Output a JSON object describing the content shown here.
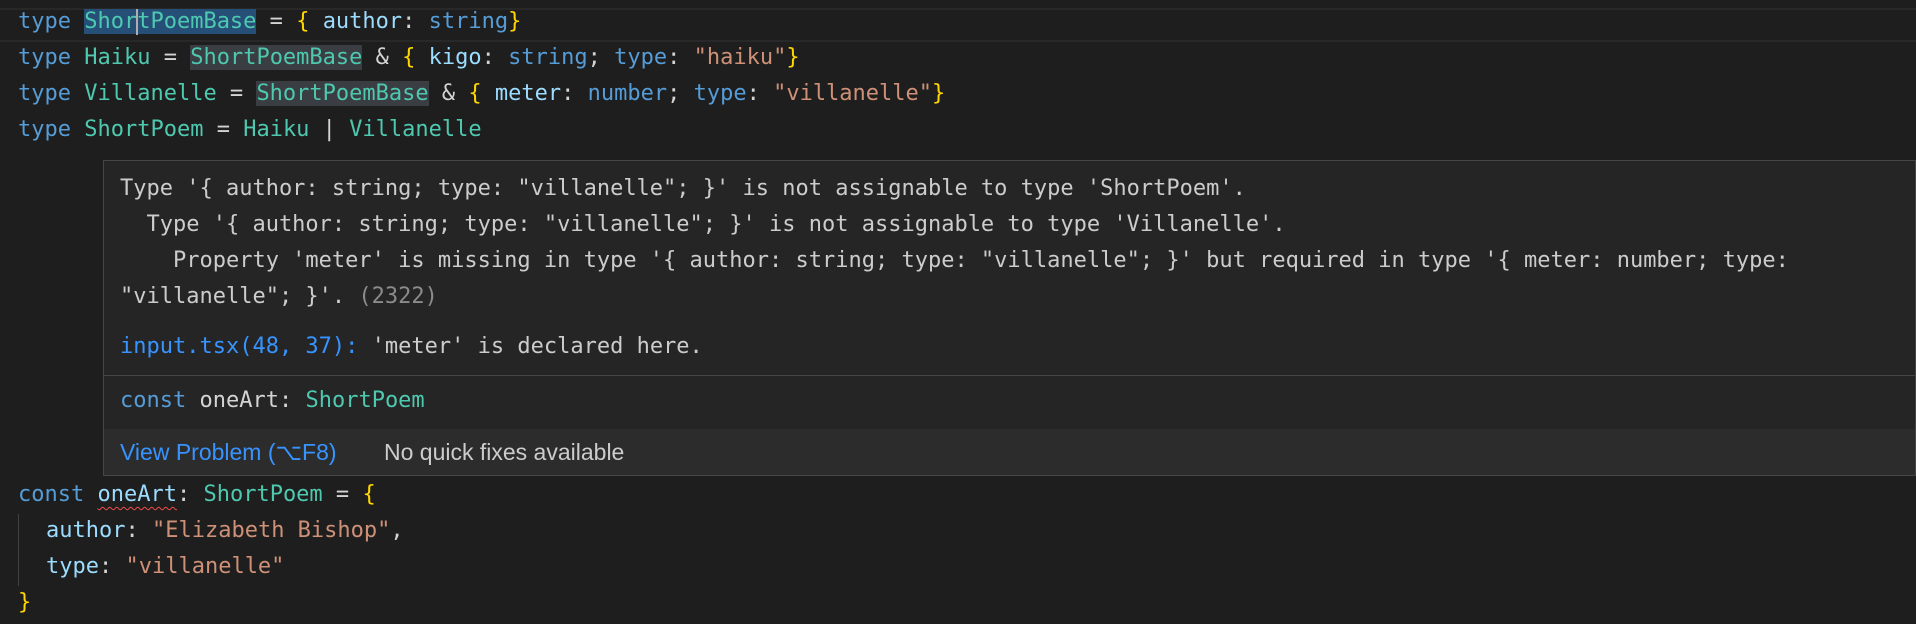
{
  "code": {
    "line1": {
      "kw": "type",
      "name_pre": "Shor",
      "name_post": "tPoemBase",
      "eq": " = ",
      "ob": "{",
      "prop": "author",
      "colon": ": ",
      "ptype": "string",
      "cb": "}"
    },
    "line2": {
      "kw": "type",
      "name": "Haiku",
      "eq": " = ",
      "base": "ShortPoemBase",
      "amp": " & ",
      "ob": "{",
      "prop1": "kigo",
      "colon1": ": ",
      "ptype1": "string",
      "semi": "; ",
      "prop2": "type",
      "colon2": ": ",
      "str": "\"haiku\"",
      "cb": "}"
    },
    "line3": {
      "kw": "type",
      "name": "Villanelle",
      "eq": " = ",
      "base": "ShortPoemBase",
      "amp": " & ",
      "ob": "{",
      "prop1": "meter",
      "colon1": ": ",
      "ptype1": "number",
      "semi": "; ",
      "prop2": "type",
      "colon2": ": ",
      "str": "\"villanelle\"",
      "cb": "}"
    },
    "line4": {
      "kw": "type",
      "name": "ShortPoem",
      "eq": " = ",
      "t1": "Haiku",
      "pipe": " | ",
      "t2": "Villanelle"
    },
    "line5": {
      "kw": "const",
      "var": "oneArt",
      "colon": ": ",
      "type": "ShortPoem",
      "eq": " = ",
      "ob": "{"
    },
    "line6": {
      "prop": "author",
      "colon": ": ",
      "str": "\"Elizabeth Bishop\"",
      "comma": ","
    },
    "line7": {
      "prop": "type",
      "colon": ": ",
      "str": "\"villanelle\""
    },
    "line8": {
      "cb": "}"
    }
  },
  "hover": {
    "messages": [
      "Type '{ author: string; type: \"villanelle\"; }' is not assignable to type 'ShortPoem'.",
      "  Type '{ author: string; type: \"villanelle\"; }' is not assignable to type 'Villanelle'.",
      "    Property 'meter' is missing in type '{ author: string; type: \"villanelle\"; }' but required in type '{ meter: number; type:",
      "\"villanelle\"; }'."
    ],
    "error_code": "(2322)",
    "related_location": "input.tsx(48, 37):",
    "related_message": "'meter' is declared here.",
    "type_info": {
      "kw": "const",
      "name": "oneArt",
      "colon": ": ",
      "type": "ShortPoem"
    },
    "actions": {
      "view_problem": "View Problem (⌥F8)",
      "quick_fix_status": "No quick fixes available"
    }
  },
  "colors": {
    "background": "#1e1e1e",
    "keyword": "#569cd6",
    "type": "#4ec9b0",
    "property": "#9cdcfe",
    "string": "#ce9178",
    "bracket": "#ffd700",
    "link": "#3794ff",
    "error_squiggle": "#f14c4c"
  }
}
